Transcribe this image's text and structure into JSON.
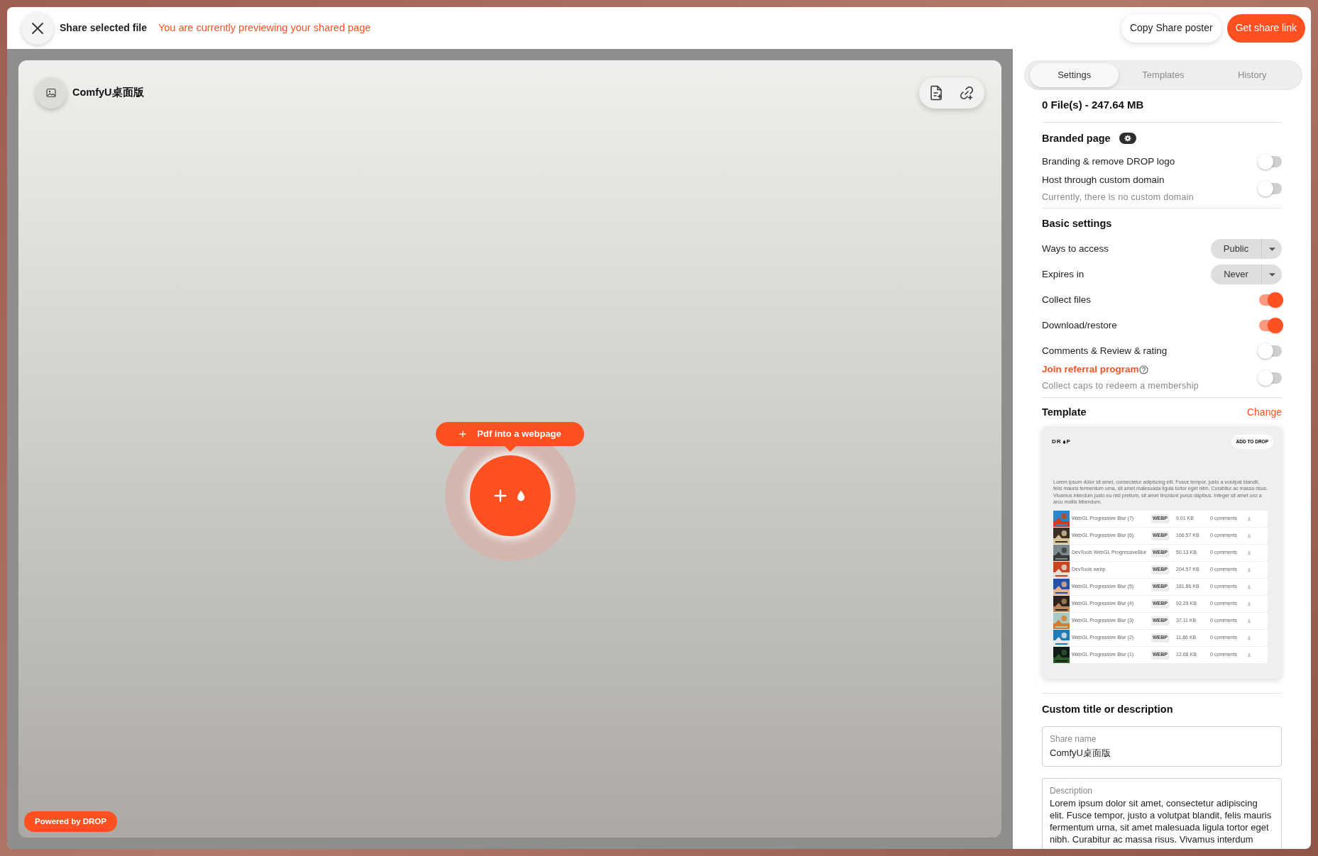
{
  "header": {
    "title": "Share selected file",
    "notice": "You are currently previewing your shared page",
    "buttons": [
      {
        "label": "Copy Share poster",
        "kind": "secondary"
      },
      {
        "label": "Get share link",
        "kind": "primary"
      }
    ]
  },
  "preview": {
    "title": "ComfyU桌面版",
    "action": "Pdf into a webpage",
    "badge": "Powered by DROP"
  },
  "tabs": [
    {
      "label": "Settings",
      "selected": true
    },
    {
      "label": "Templates",
      "selected": false
    },
    {
      "label": "History",
      "selected": false
    }
  ],
  "summary": "0 File(s) - 247.64 MB",
  "branded": {
    "heading": "Branded page",
    "settings": [
      {
        "kind": "toggle",
        "label": "Branding & remove DROP logo",
        "on": false
      },
      {
        "kind": "toggle",
        "label": "Host through custom domain",
        "hint": "Currently, there is no custom domain",
        "on": false
      }
    ]
  },
  "basic": {
    "heading": "Basic settings",
    "settings": [
      {
        "kind": "select",
        "label": "Ways to access",
        "value": "Public"
      },
      {
        "kind": "select",
        "label": "Expires in",
        "value": "Never"
      },
      {
        "kind": "toggle",
        "label": "Collect files",
        "on": true
      },
      {
        "kind": "toggle",
        "label": "Download/restore",
        "on": true
      },
      {
        "kind": "toggle",
        "label": "Comments & Review & rating",
        "on": false
      },
      {
        "kind": "link_toggle",
        "label": "Join referral program",
        "hint": "Collect caps to redeem a membership",
        "on": false
      }
    ]
  },
  "template": {
    "heading": "Template",
    "action": "Change",
    "preview": {
      "logo_before": "DR",
      "logo_after": "P",
      "button": "ADD TO DROP",
      "description": "Lorem ipsum dolor sit amet, consectetur adipiscing elit. Fusce tempor, justo a volutpat blandit, felis mauris fermentum urna, sit amet malesuada ligula tortor eget nibh. Curabitur ac massa risus. Vivamus interdum justo eu nisl pretium, sit amet tincidunt purus dapibus. Integer sit amet orci a arcu mollis bibendum.",
      "files": [
        {
          "name": "WebGL Progressive Blur (7)",
          "type": "WEBP",
          "size": "9.01 KB",
          "comments": "0 comments"
        },
        {
          "name": "WebGL Progressive Blur (6)",
          "type": "WEBP",
          "size": "166.57 KB",
          "comments": "0 comments"
        },
        {
          "name": "DevTools WebGL ProgressiveBlur",
          "type": "WEBP",
          "size": "50.13 KB",
          "comments": "0 comments"
        },
        {
          "name": "DevTools webp",
          "type": "WEBP",
          "size": "204.57 KB",
          "comments": "0 comments"
        },
        {
          "name": "WebGL Progressive Blur (5)",
          "type": "WEBP",
          "size": "181.86 KB",
          "comments": "0 comments"
        },
        {
          "name": "WebGL Progressive Blur (4)",
          "type": "WEBP",
          "size": "92.29 KB",
          "comments": "0 comments"
        },
        {
          "name": "WebGL Progressive Blur (3)",
          "type": "WEBP",
          "size": "37.11 KB",
          "comments": "0 comments"
        },
        {
          "name": "WebGL Progressive Blur (2)",
          "type": "WEBP",
          "size": "11.86 KB",
          "comments": "0 comments"
        },
        {
          "name": "WebGL Progressive Blur (1)",
          "type": "WEBP",
          "size": "12.68 KB",
          "comments": "0 comments"
        }
      ]
    }
  },
  "custom": {
    "heading": "Custom title or description",
    "fields": [
      {
        "kind": "input",
        "label": "Share name",
        "value": "ComfyU桌面版"
      },
      {
        "kind": "textarea",
        "label": "Description",
        "value": "Lorem ipsum dolor sit amet, consectetur adipiscing elit. Fusce tempor, justo a volutpat blandit, felis mauris fermentum urna, sit amet malesuada ligula tortor eget nibh. Curabitur ac massa risus. Vivamus interdum"
      }
    ]
  }
}
